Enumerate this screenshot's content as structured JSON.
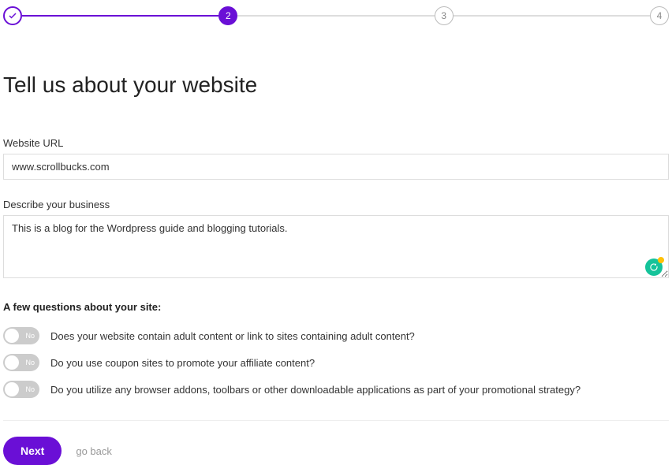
{
  "stepper": {
    "step1": "✓",
    "step2": "2",
    "step3": "3",
    "step4": "4"
  },
  "heading": "Tell us about your website",
  "fields": {
    "url_label": "Website URL",
    "url_value": "www.scrollbucks.com",
    "desc_label": "Describe your business",
    "desc_value": "This is a blog for the Wordpress guide and blogging tutorials."
  },
  "questions": {
    "heading": "A few questions about your site:",
    "toggle_off_text": "No",
    "items": [
      "Does your website contain adult content or link to sites containing adult content?",
      "Do you use coupon sites to promote your affiliate content?",
      "Do you utilize any browser addons, toolbars or other downloadable applications as part of your promotional strategy?"
    ]
  },
  "footer": {
    "next": "Next",
    "back": "go back"
  }
}
